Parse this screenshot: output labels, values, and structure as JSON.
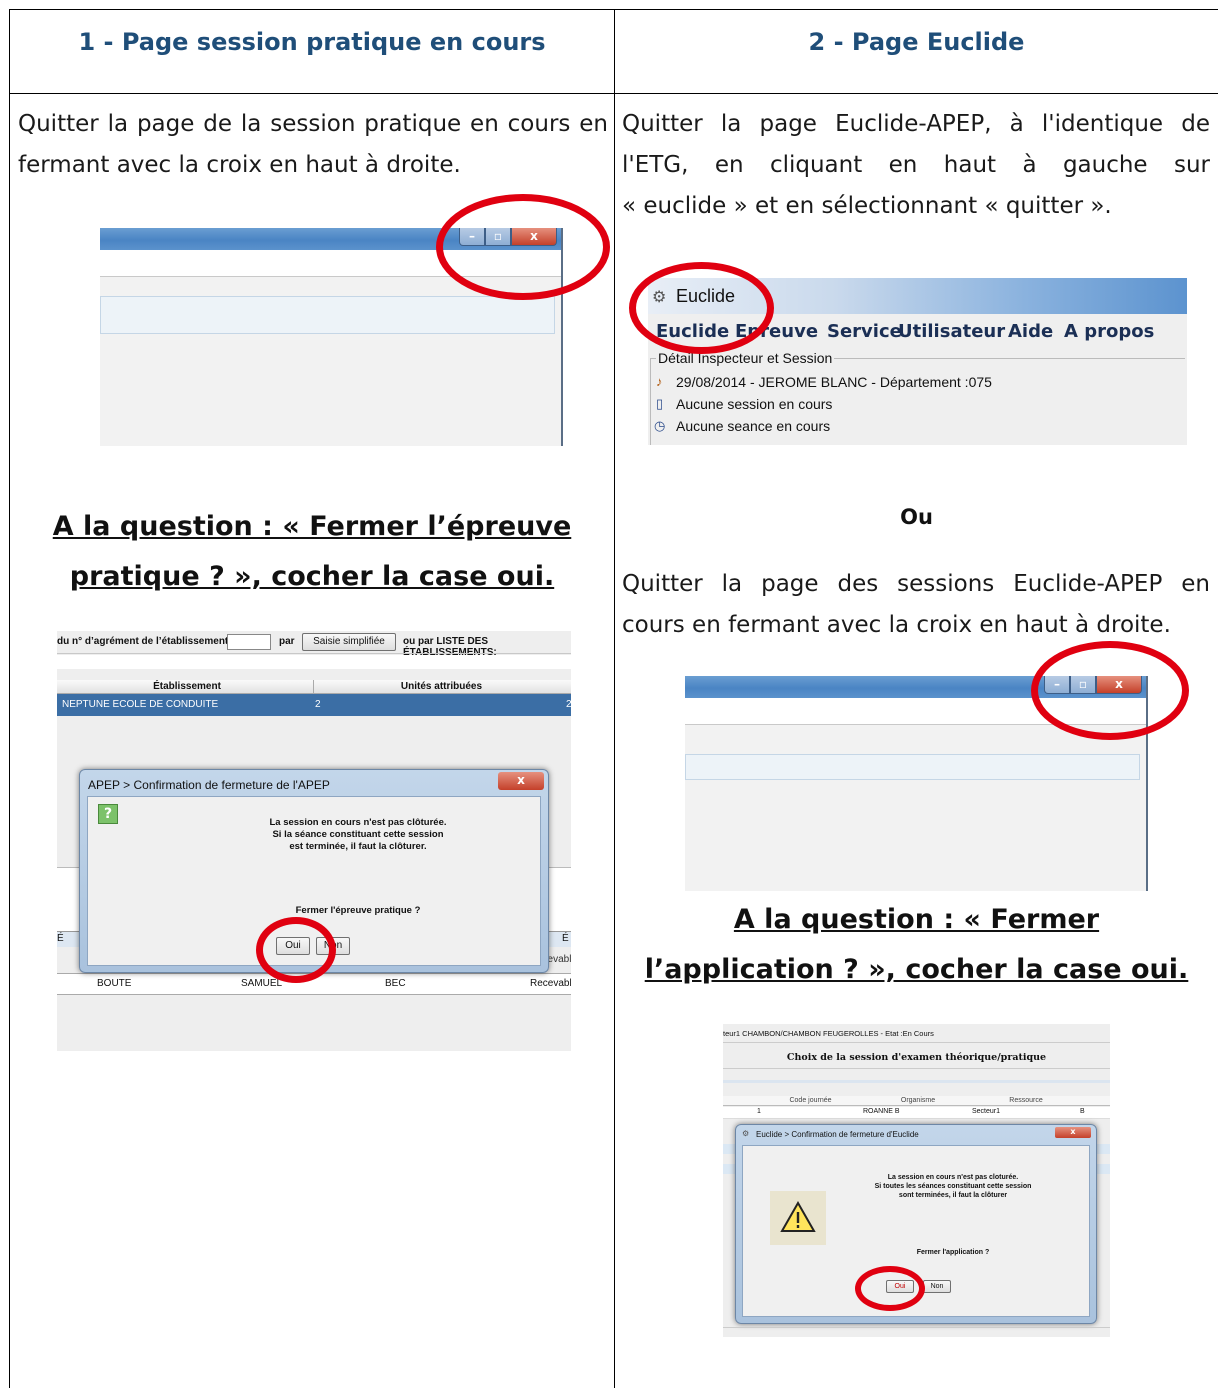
{
  "columns": [
    {
      "title": "1 - Page session pratique en cours",
      "instruction_lines": [
        "Quitter la page de la session pratique en cours en",
        "fermant avec la croix en haut à droite."
      ],
      "question_lines": [
        "A la question : «  Fermer l’épreuve",
        "pratique ? », cocher la case oui."
      ],
      "apep_screenshot": {
        "search_label": "du n° d’agrément de l’établissement:",
        "par_label": "par",
        "simple_button": "Saisie simplifiée",
        "list_label": "ou par LISTE DES ÉTABLISSEMENTS:",
        "table_headers": [
          "Établissement",
          "Unités attribuées"
        ],
        "selected_row": [
          "NEPTUNE ECOLE DE CONDUITE",
          "2",
          "2"
        ],
        "bottom_row": [
          "BOUTE",
          "SAMUEL",
          "BEC",
          "Recevabl"
        ],
        "partial_cells": [
          "É",
          "ecevabl"
        ],
        "dialog": {
          "title": "APEP > Confirmation de fermeture de l'APEP",
          "close_glyph": "x",
          "icon": "?",
          "message_lines": [
            "La session en cours n'est pas clôturée.",
            "Si la séance constituant cette session",
            "est terminée, il faut la clôturer."
          ],
          "question": "Fermer l'épreuve pratique ?",
          "yes": "Oui",
          "no": "Non"
        }
      }
    },
    {
      "title": "2 - Page Euclide",
      "instruction_lines": [
        "Quitter la page Euclide-APEP, à l'identique de",
        "l'ETG, en cliquant en haut à gauche sur",
        "« euclide » et en sélectionnant « quitter »."
      ],
      "euclide_screenshot": {
        "window_title": "Euclide",
        "menu": [
          "Euclide",
          "Epreuve",
          "Service",
          "Utilisateur",
          "Aide",
          "A propos"
        ],
        "group_title": "Détail Inspecteur et Session",
        "info_lines": [
          "29/08/2014 - JEROME BLANC - Département :075",
          "Aucune session en cours",
          "Aucune seance en cours"
        ]
      },
      "or_label": "Ou",
      "instruction2_lines": [
        "Quitter la page des sessions Euclide-APEP en",
        "cours en fermant avec la croix en haut à droite."
      ],
      "question_lines": [
        "A la question : «  Fermer",
        "l’application ? », cocher la case oui."
      ],
      "sessions_screenshot": {
        "header": "teur1 CHAMBON/CHAMBON FEUGEROLLES - Etat :En Cours",
        "title": "Choix de la session d'examen théorique/pratique",
        "table_headers": [
          "Code journée",
          "Organisme",
          "Ressource"
        ],
        "row": [
          "1",
          "ROANNE B",
          "Secteur1",
          "B"
        ],
        "dialog": {
          "title": "Euclide > Confirmation de fermeture d'Euclide",
          "close_glyph": "x",
          "message_lines": [
            "La session en cours n'est pas cloturée.",
            "Si toutes les séances constituant cette session",
            "sont terminées, il faut la clôturer"
          ],
          "question": "Fermer l'application ?",
          "yes": "Oui",
          "no": "Non"
        }
      }
    }
  ],
  "window_buttons": [
    "–",
    "▫",
    "x"
  ]
}
